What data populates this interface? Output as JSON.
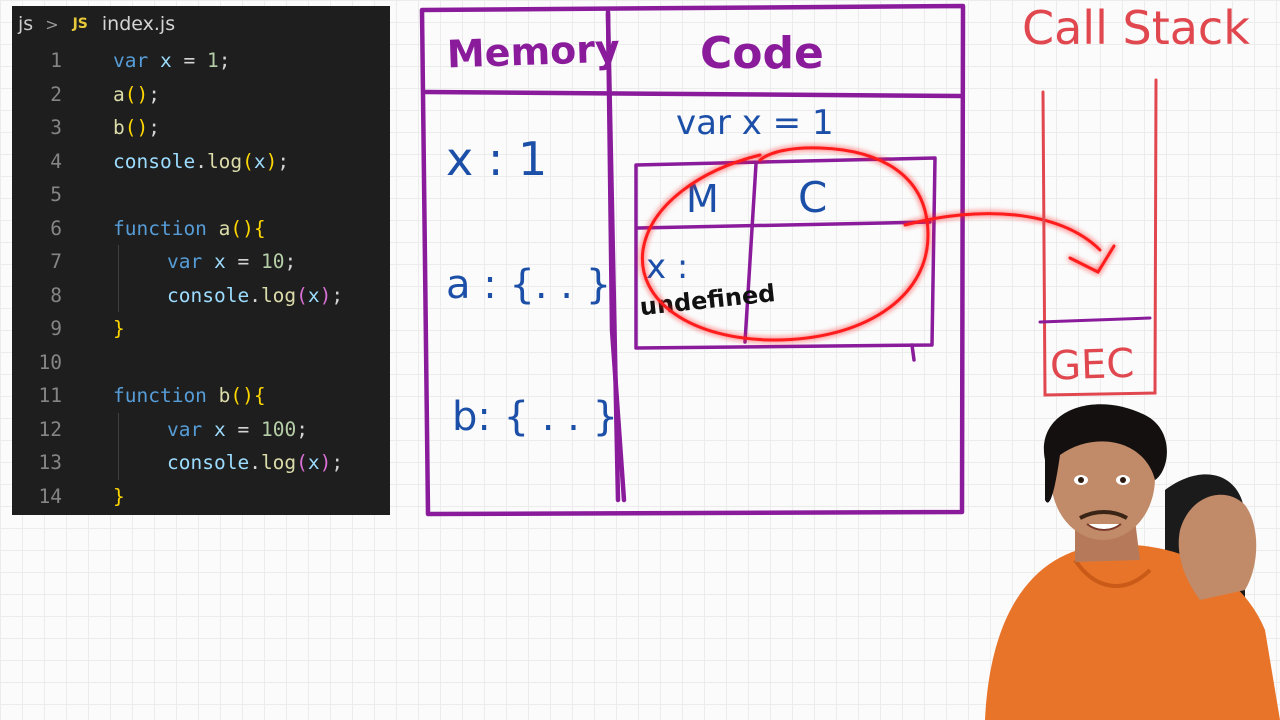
{
  "editor": {
    "breadcrumb": {
      "folder": "js",
      "separator": ">",
      "badge": "JS",
      "file": "index.js"
    },
    "lines": [
      {
        "n": "1",
        "code": "var x = 1;"
      },
      {
        "n": "2",
        "code": "a();"
      },
      {
        "n": "3",
        "code": "b();"
      },
      {
        "n": "4",
        "code": "console.log(x);"
      },
      {
        "n": "5",
        "code": ""
      },
      {
        "n": "6",
        "code": "function a(){"
      },
      {
        "n": "7",
        "code": "var x = 10;"
      },
      {
        "n": "8",
        "code": "console.log(x);"
      },
      {
        "n": "9",
        "code": "}"
      },
      {
        "n": "10",
        "code": ""
      },
      {
        "n": "11",
        "code": "function b(){"
      },
      {
        "n": "12",
        "code": "var x = 100;"
      },
      {
        "n": "13",
        "code": "console.log(x);"
      },
      {
        "n": "14",
        "code": "}"
      }
    ]
  },
  "diagram": {
    "memory_header": "Memory",
    "code_header": "Code",
    "memory_entries": {
      "x": "x : 1",
      "a": "a : {. . }",
      "b": "b: { . . }"
    },
    "code_line": "var x = 1",
    "inner_context": {
      "m_header": "M",
      "c_header": "C",
      "x_entry": "x :",
      "x_value": "undefined"
    },
    "call_stack_title": "Call Stack",
    "call_stack_base": "GEC"
  },
  "colors": {
    "editor_bg": "#1e1e1e",
    "box_purple": "#8a1c9c",
    "ink_blue": "#1c4fa8",
    "stack_red": "#e0474f",
    "highlight_red": "#ff1a1a"
  },
  "icons": {
    "presenter": "presenter-avatar"
  }
}
